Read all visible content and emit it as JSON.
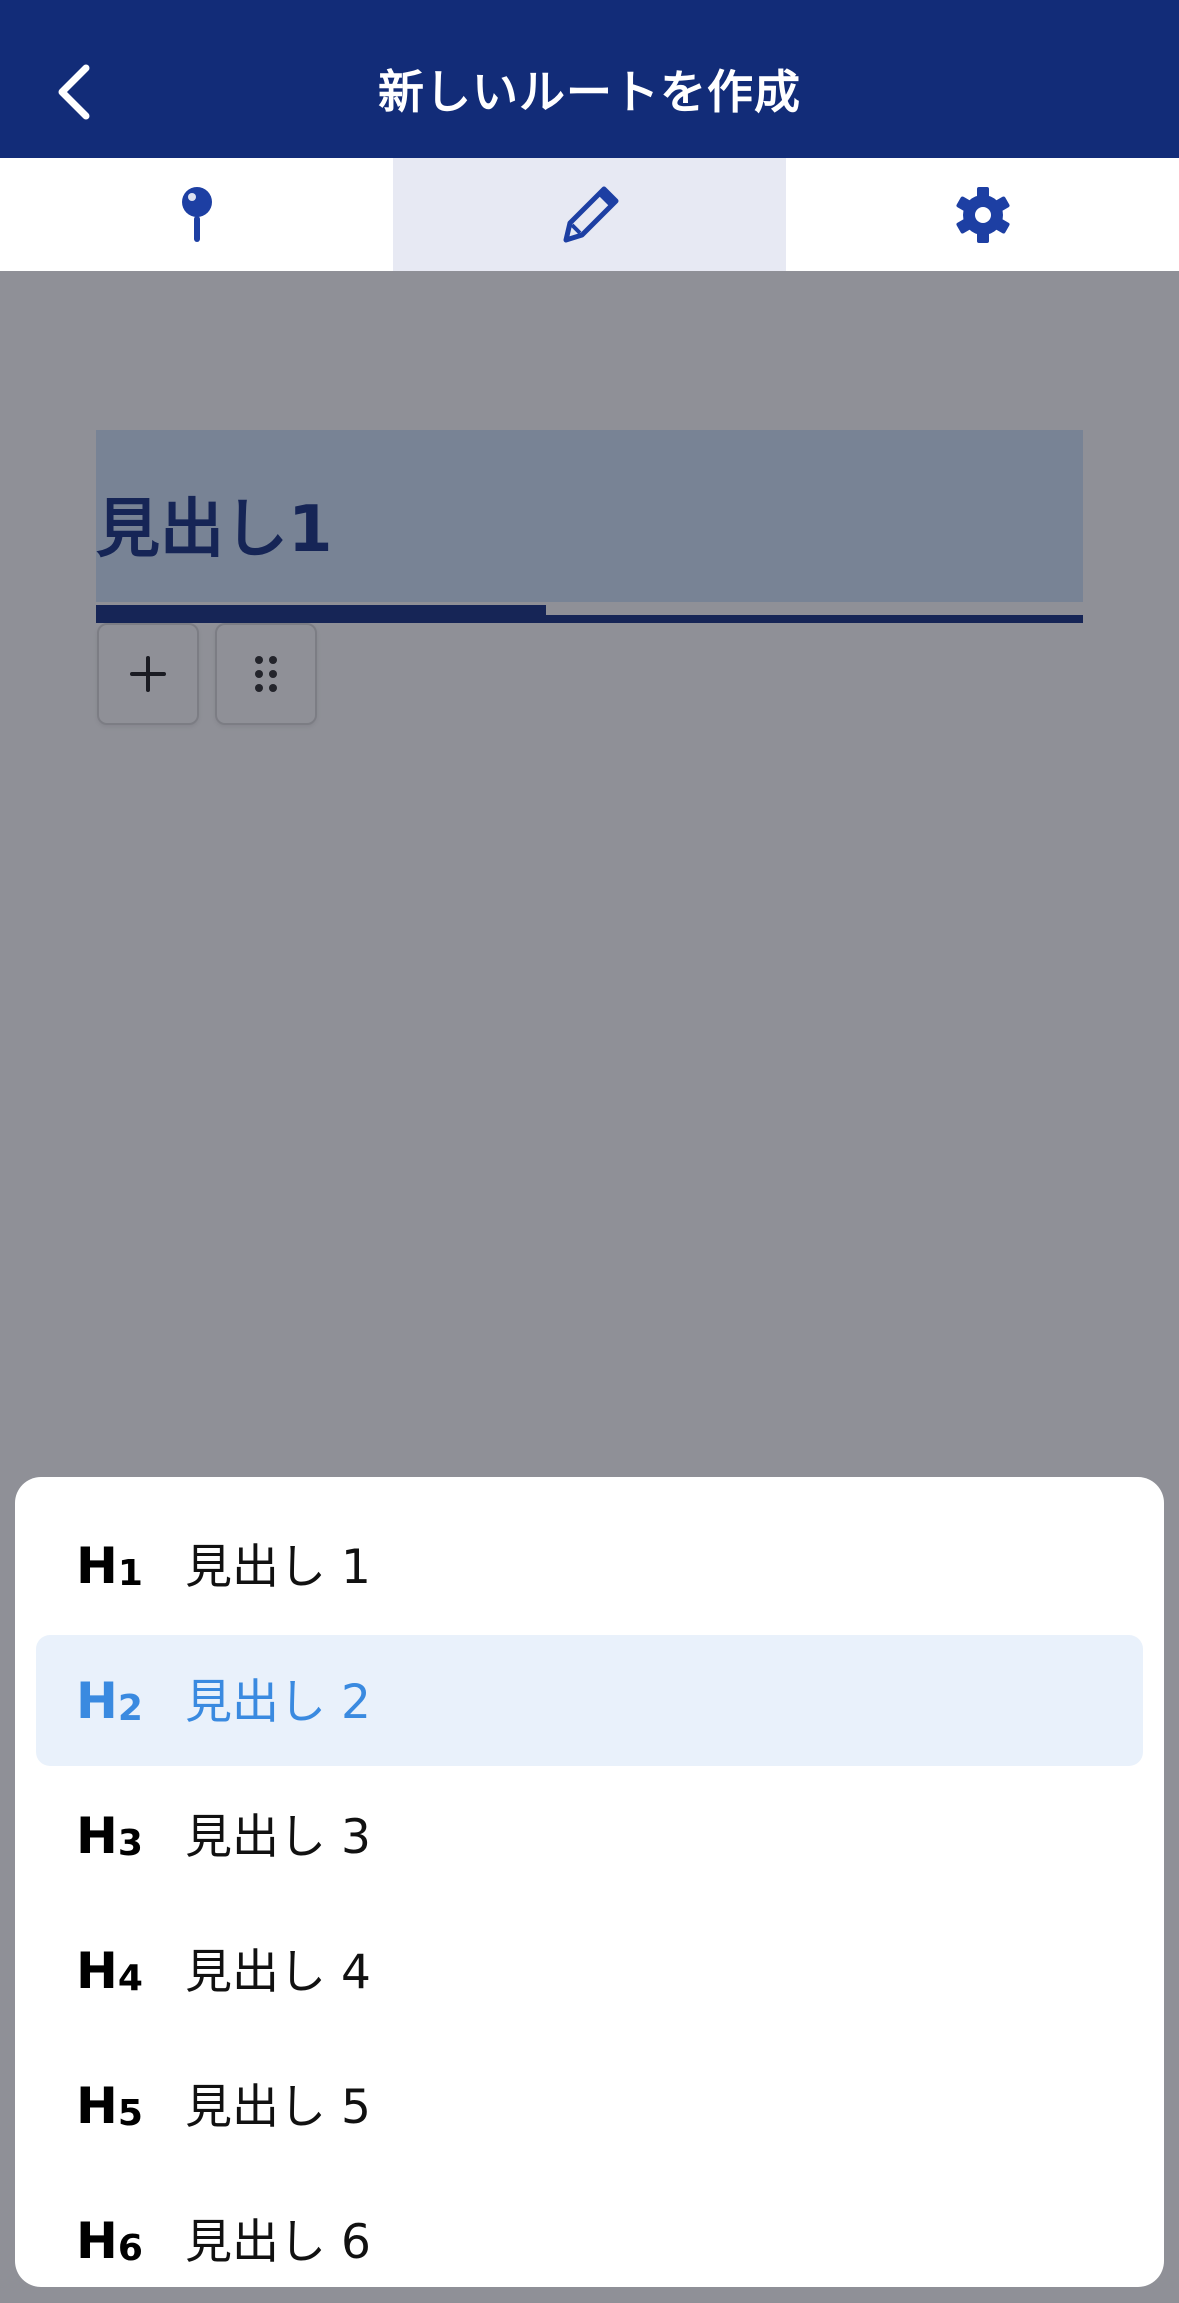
{
  "header": {
    "title": "新しいルートを作成"
  },
  "tabs": [
    {
      "name": "location",
      "icon": "map-pin-icon",
      "active": false
    },
    {
      "name": "edit",
      "icon": "pencil-icon",
      "active": true
    },
    {
      "name": "settings",
      "icon": "gear-icon",
      "active": false
    }
  ],
  "editor": {
    "heading_text": "見出し1"
  },
  "toolbar": {
    "add_icon": "plus-icon",
    "drag_icon": "drag-handle-icon"
  },
  "heading_menu": {
    "selected_index": 1,
    "items": [
      {
        "icon_letter": "H",
        "icon_num": "1",
        "label": "見出し 1"
      },
      {
        "icon_letter": "H",
        "icon_num": "2",
        "label": "見出し 2"
      },
      {
        "icon_letter": "H",
        "icon_num": "3",
        "label": "見出し 3"
      },
      {
        "icon_letter": "H",
        "icon_num": "4",
        "label": "見出し 4"
      },
      {
        "icon_letter": "H",
        "icon_num": "5",
        "label": "見出し 5"
      },
      {
        "icon_letter": "H",
        "icon_num": "6",
        "label": "見出し 6"
      }
    ]
  },
  "colors": {
    "header_bg": "#122c78",
    "accent": "#1b3684",
    "selected_text": "#3a8ae0",
    "selected_bg": "#e9f1fb"
  }
}
